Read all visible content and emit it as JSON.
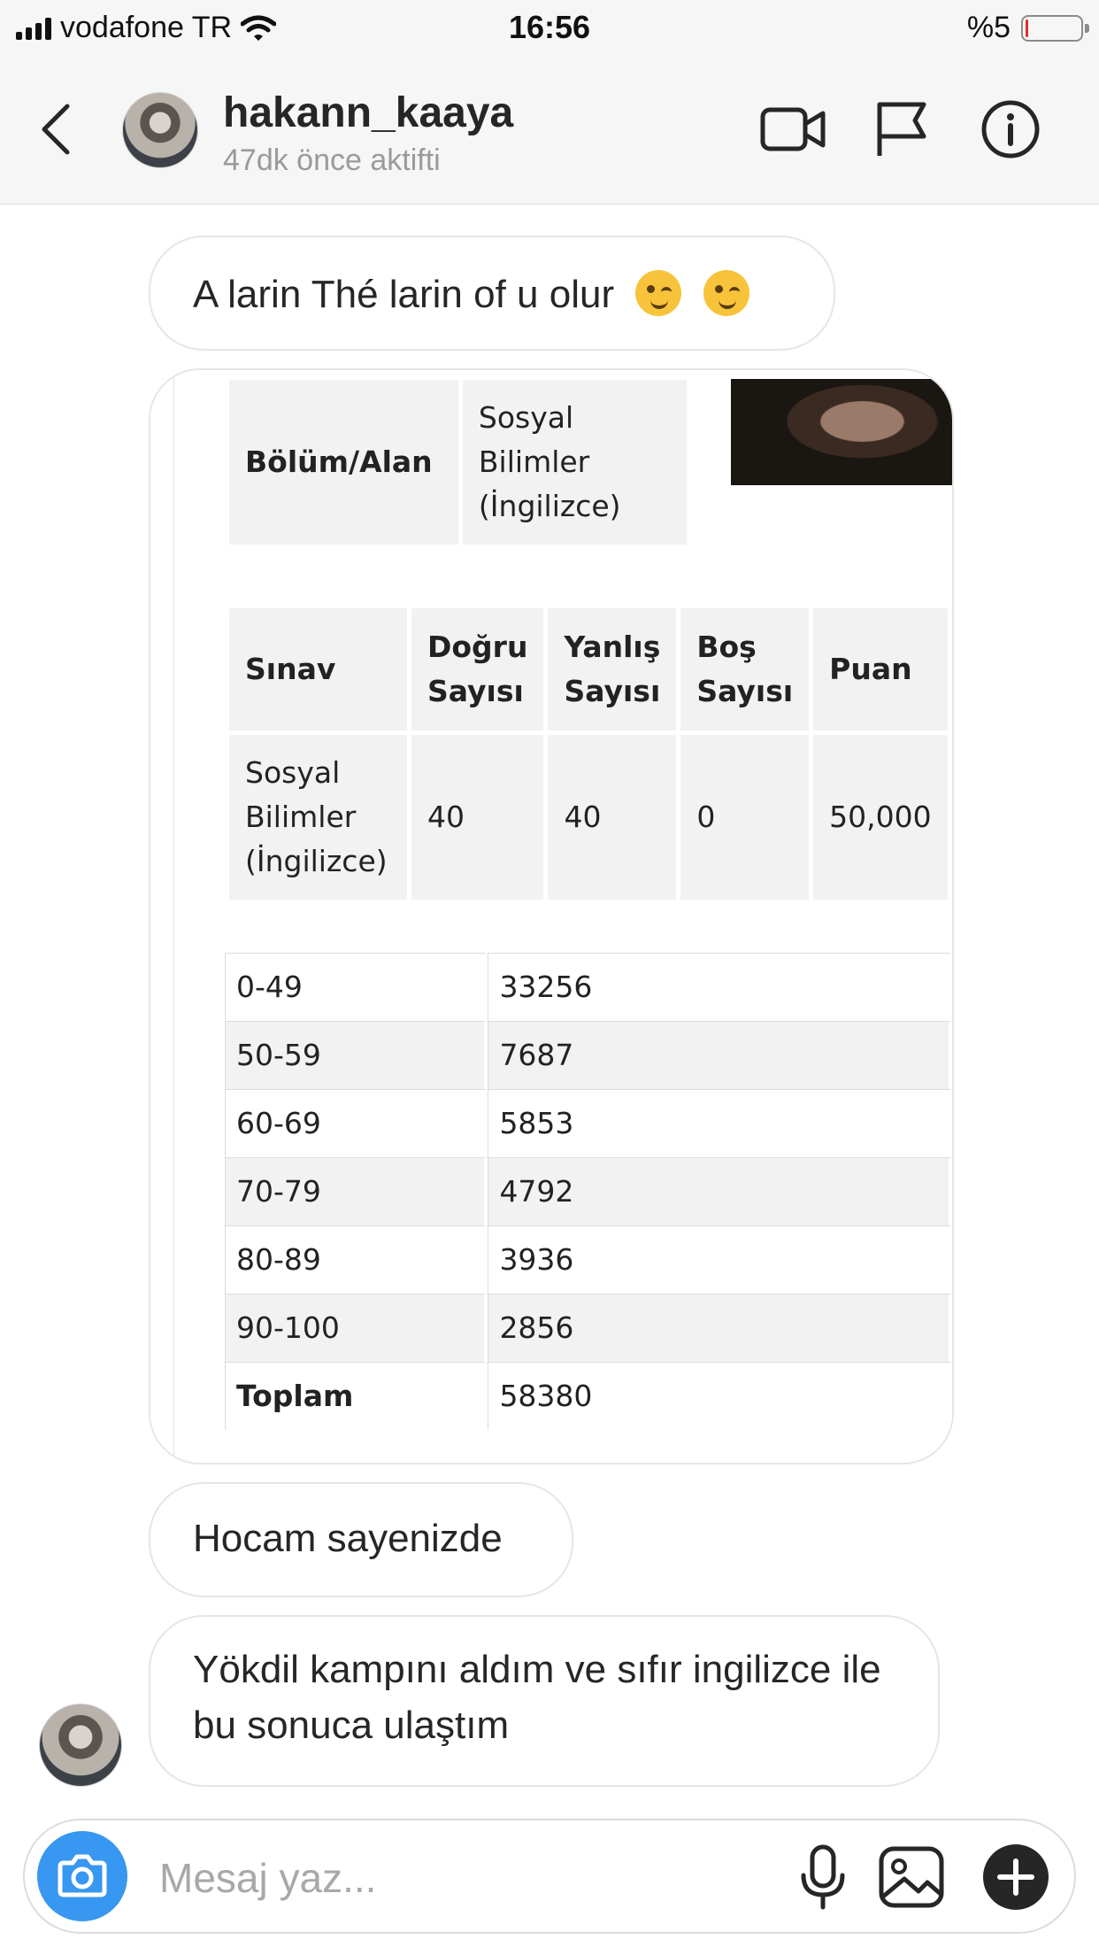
{
  "status_bar": {
    "carrier": "vodafone TR",
    "time": "16:56",
    "battery": "%5",
    "battery_level": 0.05
  },
  "header": {
    "username": "hakann_kaaya",
    "active_status": "47dk önce aktifti"
  },
  "messages": [
    {
      "text": "A larin Thé larin of u olur",
      "emojis": [
        "winking-face",
        "winking-face"
      ]
    },
    {
      "type": "image",
      "content": {
        "info_table": {
          "label": "Bölüm/Alan",
          "value": "Sosyal Bilimler (İngilizce)"
        },
        "result_table": {
          "headers": [
            "Sınav",
            "Doğru Sayısı",
            "Yanlış Sayısı",
            "Boş Sayısı",
            "Puan"
          ],
          "row": [
            "Sosyal Bilimler (İngilizce)",
            "40",
            "40",
            "0",
            "50,000"
          ]
        },
        "distribution": [
          [
            "0-49",
            "33256"
          ],
          [
            "50-59",
            "7687"
          ],
          [
            "60-69",
            "5853"
          ],
          [
            "70-79",
            "4792"
          ],
          [
            "80-89",
            "3936"
          ],
          [
            "90-100",
            "2856"
          ],
          [
            "Toplam",
            "58380"
          ]
        ]
      }
    },
    {
      "text": "Hocam sayenizde"
    },
    {
      "text": "Yökdil kampını aldım ve sıfır ingilizce ile bu sonuca ulaştım"
    }
  ],
  "input": {
    "placeholder": "Mesaj yaz..."
  },
  "colors": {
    "accent": "#3897f0",
    "battery_low": "#e0302a"
  }
}
